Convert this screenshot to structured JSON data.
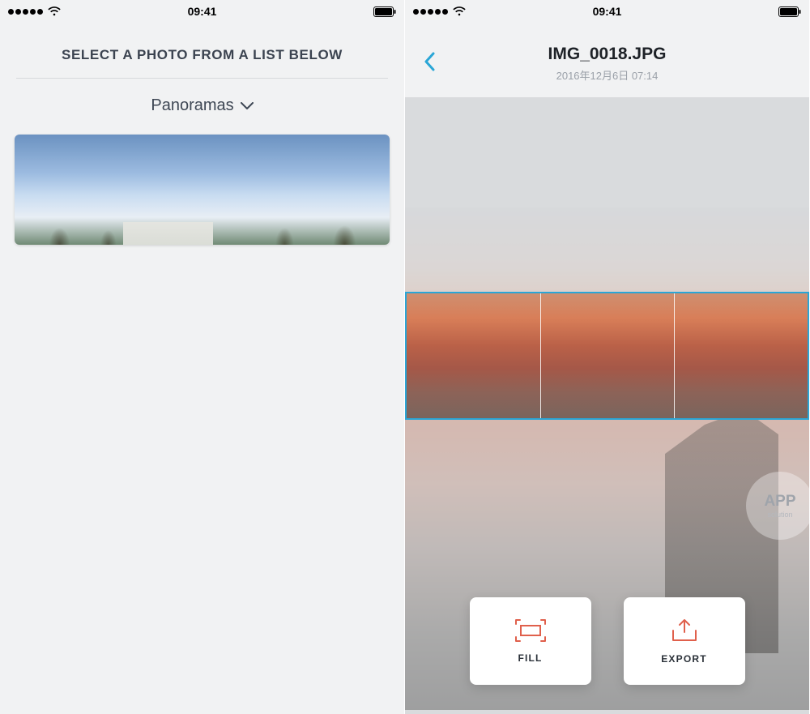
{
  "status": {
    "time": "09:41"
  },
  "screen1": {
    "title": "SELECT A PHOTO FROM A LIST BELOW",
    "album_label": "Panoramas"
  },
  "screen2": {
    "file_title": "IMG_0018.JPG",
    "file_subtitle": "2016年12月6日 07:14",
    "fill_label": "FILL",
    "export_label": "EXPORT",
    "watermark_big": "APP",
    "watermark_small": "solution"
  }
}
